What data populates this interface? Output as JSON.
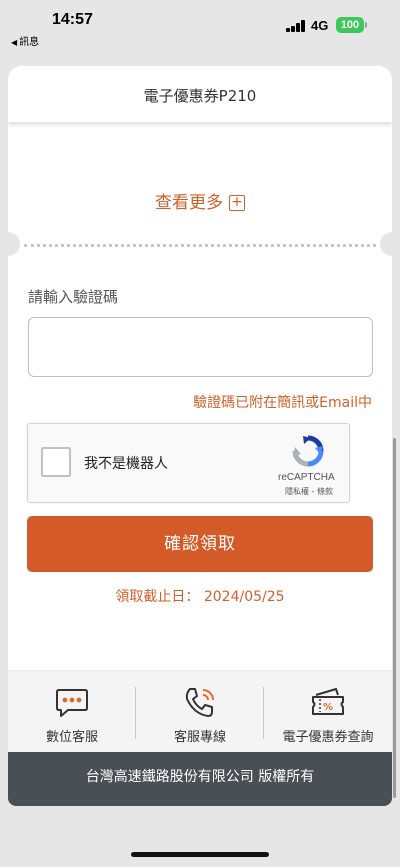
{
  "status": {
    "time": "14:57",
    "back_label": "訊息",
    "network": "4G",
    "battery": "100"
  },
  "card": {
    "title": "電子優惠券P210",
    "more_label": "查看更多",
    "verify_label": "請輸入驗證碼",
    "verify_value": "",
    "verify_hint": "驗證碼已附在簡訊或Email中",
    "recaptcha": {
      "label": "我不是機器人",
      "brand": "reCAPTCHA",
      "terms": "隱私權 - 條款"
    },
    "confirm_label": "確認領取",
    "deadline": "領取截止日： 2024/05/25"
  },
  "footer": {
    "links": [
      {
        "label": "數位客服",
        "icon": "chat-bubble-icon"
      },
      {
        "label": "客服專線",
        "icon": "phone-icon"
      },
      {
        "label": "電子優惠券查詢",
        "icon": "coupon-ticket-icon"
      }
    ],
    "copyright": "台灣高速鐵路股份有限公司 版權所有"
  },
  "colors": {
    "accent": "#d45a27",
    "footer_bg": "#4a4f56",
    "page_bg": "#e6e6e6"
  }
}
